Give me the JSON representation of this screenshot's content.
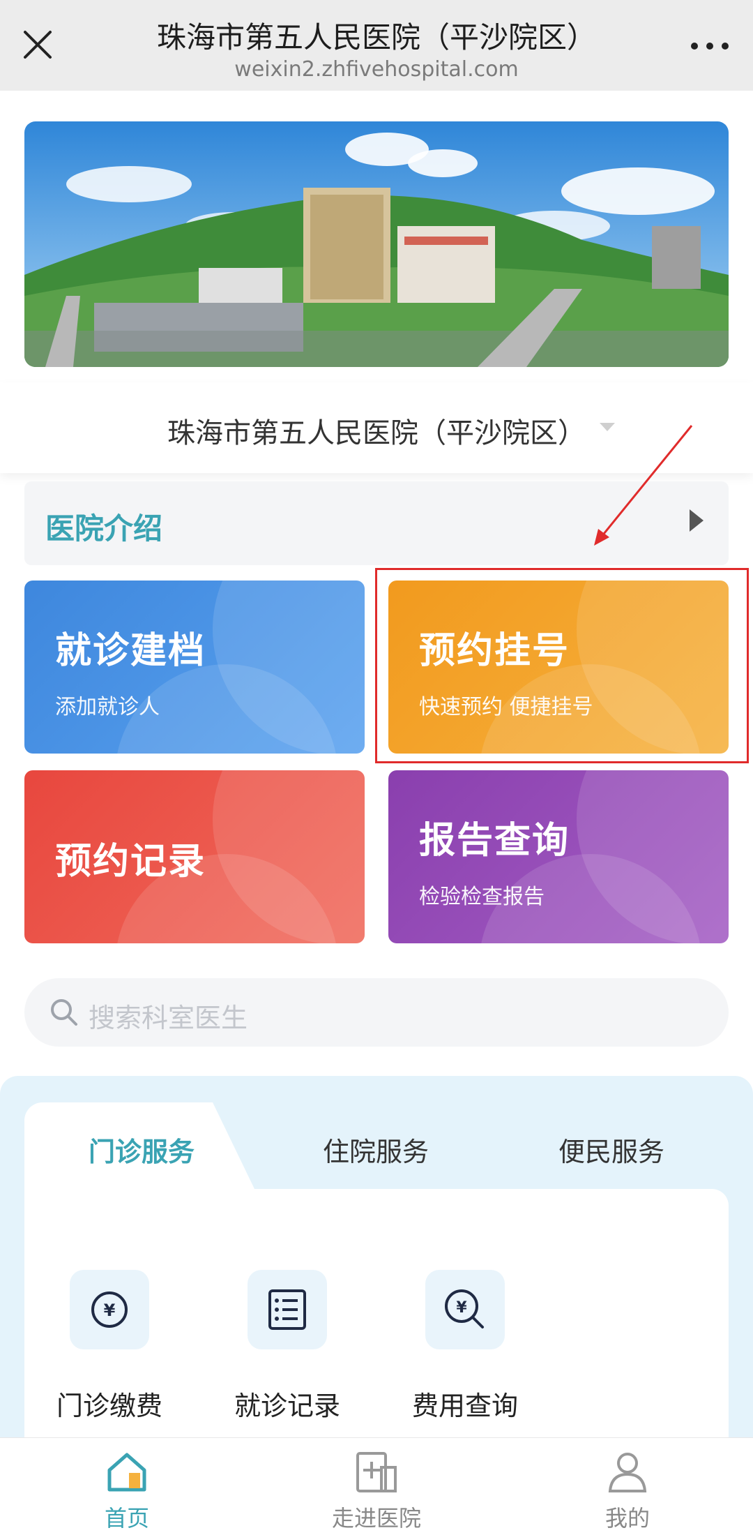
{
  "topbar": {
    "title": "珠海市第五人民医院（平沙院区）",
    "url": "weixin2.zhfivehospital.com",
    "close_icon": "close-icon",
    "more_icon": "more-dots-icon"
  },
  "hospital_selector": {
    "name": "珠海市第五人民医院（平沙院区）",
    "caret_icon": "caret-down-icon"
  },
  "intro": {
    "label": "医院介绍",
    "arrow_icon": "chevron-right-icon"
  },
  "cards": [
    {
      "title": "就诊建档",
      "subtitle": "添加就诊人",
      "color": "#4a90e2"
    },
    {
      "title": "预约挂号",
      "subtitle": "快速预约 便捷挂号",
      "color": "#f3a52c"
    },
    {
      "title": "预约记录",
      "subtitle": "",
      "color": "#ec564a"
    },
    {
      "title": "报告查询",
      "subtitle": "检验检查报告",
      "color": "#9a4fbb"
    }
  ],
  "search": {
    "placeholder": "搜索科室医生"
  },
  "services": {
    "tabs": [
      "门诊服务",
      "住院服务",
      "便民服务"
    ],
    "active_tab": 0,
    "items": [
      {
        "label": "门诊缴费",
        "icon": "yuan-circle-icon"
      },
      {
        "label": "就诊记录",
        "icon": "list-icon"
      },
      {
        "label": "费用查询",
        "icon": "yuan-search-icon"
      }
    ]
  },
  "bottom_nav": {
    "items": [
      {
        "label": "首页",
        "icon": "home-icon",
        "active": true
      },
      {
        "label": "走进医院",
        "icon": "hospital-plus-icon",
        "active": false
      },
      {
        "label": "我的",
        "icon": "user-icon",
        "active": false
      }
    ]
  },
  "colors": {
    "accent": "#3aa3b3",
    "highlight": "#e02b2b"
  }
}
